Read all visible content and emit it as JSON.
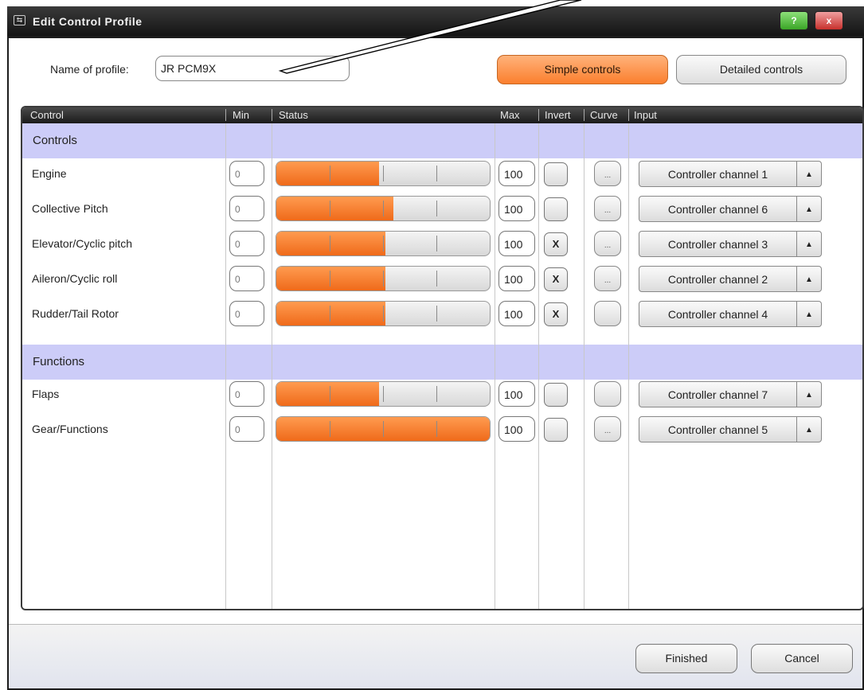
{
  "window": {
    "title": "Edit Control Profile",
    "help_label": "?",
    "close_label": "x"
  },
  "profile": {
    "name_label": "Name of profile:",
    "name_value": "JR PCM9X"
  },
  "mode_buttons": {
    "simple_label": "Simple controls",
    "detailed_label": "Detailed controls"
  },
  "columns": {
    "control": "Control",
    "min": "Min",
    "status": "Status",
    "max": "Max",
    "invert": "Invert",
    "curve": "Curve",
    "input": "Input"
  },
  "sections": [
    {
      "label": "Controls",
      "rows": [
        {
          "control": "Engine",
          "min": "0",
          "max": "100",
          "status_fraction": 0.48,
          "invert": "",
          "curve": "...",
          "input": "Controller channel 1",
          "arrow": "▲"
        },
        {
          "control": "Collective Pitch",
          "min": "0",
          "max": "100",
          "status_fraction": 0.55,
          "invert": "",
          "curve": "...",
          "input": "Controller channel 6",
          "arrow": "▲"
        },
        {
          "control": "Elevator/Cyclic pitch",
          "min": "0",
          "max": "100",
          "status_fraction": 0.51,
          "invert": "X",
          "curve": "...",
          "input": "Controller channel 3",
          "arrow": "▲"
        },
        {
          "control": "Aileron/Cyclic roll",
          "min": "0",
          "max": "100",
          "status_fraction": 0.51,
          "invert": "X",
          "curve": "...",
          "input": "Controller channel 2",
          "arrow": "▲"
        },
        {
          "control": "Rudder/Tail Rotor",
          "min": "0",
          "max": "100",
          "status_fraction": 0.51,
          "invert": "X",
          "curve": "",
          "input": "Controller channel 4",
          "arrow": "▲"
        }
      ]
    },
    {
      "label": "Functions",
      "rows": [
        {
          "control": "Flaps",
          "min": "0",
          "max": "100",
          "status_fraction": 0.48,
          "invert": "",
          "curve": "",
          "input": "Controller channel 7",
          "arrow": "▲"
        },
        {
          "control": "Gear/Functions",
          "min": "0",
          "max": "100",
          "status_fraction": 1.0,
          "invert": "",
          "curve": "...",
          "input": "Controller channel 5",
          "arrow": "▲"
        }
      ]
    }
  ],
  "footer": {
    "finished_label": "Finished",
    "cancel_label": "Cancel"
  },
  "colors": {
    "accent_orange": "#fb7f2e",
    "section_band": "#ccccf8",
    "title_bar": "#1c1c1c"
  }
}
